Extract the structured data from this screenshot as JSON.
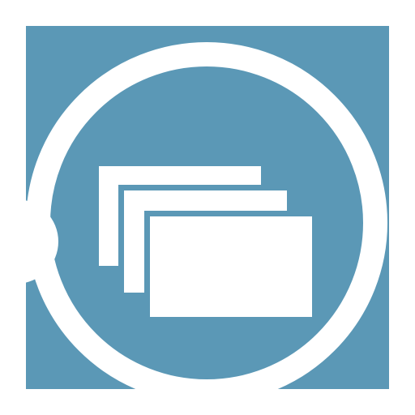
{
  "icon": {
    "name": "task-switcher-windows-icon",
    "background_color": "#ffffff",
    "tile_color": "#5b98b6",
    "symbol_color": "#ffffff"
  }
}
